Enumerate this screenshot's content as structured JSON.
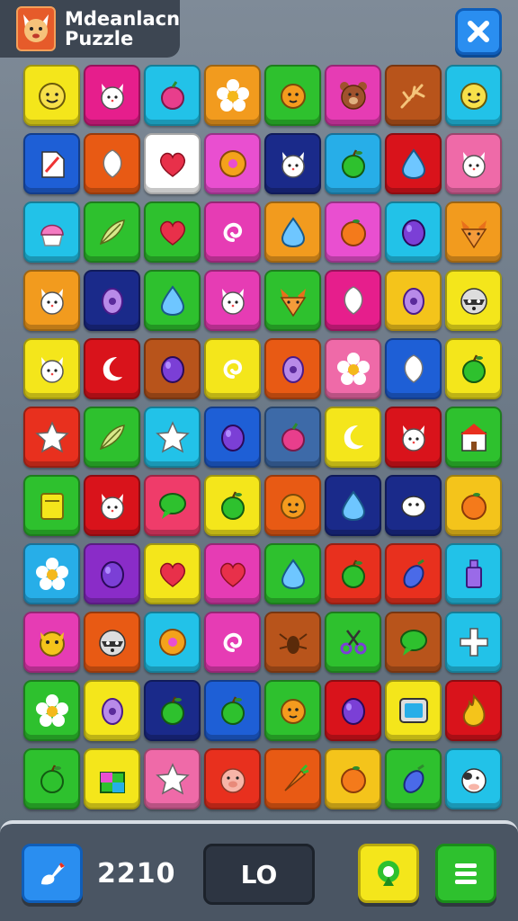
{
  "header": {
    "title_line1": "Mdeanlacn",
    "title_line2": "Puzzle"
  },
  "footer": {
    "score": "2210",
    "center_label": "LO"
  },
  "board": {
    "rows": [
      [
        [
          "#f4e61b",
          "smiley-fruit-icon"
        ],
        [
          "#e61e8c",
          "cat-icon"
        ],
        [
          "#22c2e8",
          "berry-icon"
        ],
        [
          "#f29b1e",
          "flower-icon"
        ],
        [
          "#2ec12e",
          "face-icon"
        ],
        [
          "#e63cb4",
          "bear-icon"
        ],
        [
          "#b8541b",
          "branch-icon"
        ],
        [
          "#22c2e8",
          "smiley-fruit-icon"
        ]
      ],
      [
        [
          "#1e5fd6",
          "paper-icon"
        ],
        [
          "#e85a14",
          "leaf-icon"
        ],
        [
          "#ffffff",
          "heart-icon"
        ],
        [
          "#e94fd0",
          "donut-icon"
        ],
        [
          "#1a2a8a",
          "cat-icon"
        ],
        [
          "#27aee8",
          "apple-icon"
        ],
        [
          "#d9131b",
          "drop-icon"
        ],
        [
          "#ef6aa8",
          "cat-icon"
        ]
      ],
      [
        [
          "#22c2e8",
          "cupcake-icon"
        ],
        [
          "#2ec12e",
          "feather-icon"
        ],
        [
          "#2ec12e",
          "heart-icon"
        ],
        [
          "#e63cb4",
          "swirl-icon"
        ],
        [
          "#f29b1e",
          "drop-icon"
        ],
        [
          "#e94fd0",
          "orange-icon"
        ],
        [
          "#22c2e8",
          "plum-icon"
        ],
        [
          "#f29b1e",
          "fox-icon"
        ]
      ],
      [
        [
          "#f29b1e",
          "cat-icon"
        ],
        [
          "#1a2a8a",
          "egg-icon"
        ],
        [
          "#2ec12e",
          "drop-icon"
        ],
        [
          "#e63cb4",
          "cat-icon"
        ],
        [
          "#2ec12e",
          "fox-icon"
        ],
        [
          "#e61e8c",
          "leaf-icon"
        ],
        [
          "#f4c41b",
          "egg-icon"
        ],
        [
          "#f4e61b",
          "raccoon-icon"
        ]
      ],
      [
        [
          "#f4e61b",
          "cat-icon"
        ],
        [
          "#d9131b",
          "moon-icon"
        ],
        [
          "#b8541b",
          "plum-icon"
        ],
        [
          "#f4e61b",
          "swirl-icon"
        ],
        [
          "#e85a14",
          "egg-icon"
        ],
        [
          "#ef6aa8",
          "flower-icon"
        ],
        [
          "#1e5fd6",
          "leaf-icon"
        ],
        [
          "#f4e61b",
          "apple-icon"
        ]
      ],
      [
        [
          "#e8301e",
          "star-icon"
        ],
        [
          "#2ec12e",
          "feather-icon"
        ],
        [
          "#22c2e8",
          "star-icon"
        ],
        [
          "#1e5fd6",
          "plum-icon"
        ],
        [
          "#3d6aa8",
          "berry-icon"
        ],
        [
          "#f4e61b",
          "moon-icon"
        ],
        [
          "#d9131b",
          "cat-icon"
        ],
        [
          "#2ec12e",
          "house-icon"
        ]
      ],
      [
        [
          "#2ec12e",
          "note-icon"
        ],
        [
          "#d9131b",
          "cat-icon"
        ],
        [
          "#ef3c6a",
          "chat-icon"
        ],
        [
          "#f4e61b",
          "apple-icon"
        ],
        [
          "#e85a14",
          "face-icon"
        ],
        [
          "#1a2a8a",
          "drop-icon"
        ],
        [
          "#1a2a8a",
          "ghost-icon"
        ],
        [
          "#f4c41b",
          "orange-icon"
        ]
      ],
      [
        [
          "#27aee8",
          "flower-icon"
        ],
        [
          "#8a2cc8",
          "plum-icon"
        ],
        [
          "#f4e61b",
          "heart-icon"
        ],
        [
          "#e63cb4",
          "heart-icon"
        ],
        [
          "#2ec12e",
          "drop-icon"
        ],
        [
          "#e8301e",
          "apple-icon"
        ],
        [
          "#e8301e",
          "eggplant-icon"
        ],
        [
          "#22c2e8",
          "bottle-icon"
        ]
      ],
      [
        [
          "#e63cb4",
          "owl-icon"
        ],
        [
          "#e85a14",
          "raccoon-icon"
        ],
        [
          "#22c2e8",
          "donut-icon"
        ],
        [
          "#e63cb4",
          "swirl-icon"
        ],
        [
          "#b8541b",
          "bug-icon"
        ],
        [
          "#2ec12e",
          "scissors-icon"
        ],
        [
          "#b8541b",
          "chat-icon"
        ],
        [
          "#22c2e8",
          "cross-icon"
        ]
      ],
      [
        [
          "#2ec12e",
          "flower-icon"
        ],
        [
          "#f4e61b",
          "egg-icon"
        ],
        [
          "#1a2a8a",
          "apple-icon"
        ],
        [
          "#1e5fd6",
          "apple-icon"
        ],
        [
          "#2ec12e",
          "face-icon"
        ],
        [
          "#d9131b",
          "plum-icon"
        ],
        [
          "#f4e61b",
          "tv-icon"
        ],
        [
          "#d9131b",
          "flame-icon"
        ]
      ],
      [
        [
          "#2ec12e",
          "apple-icon"
        ],
        [
          "#f4e61b",
          "box-icon"
        ],
        [
          "#ef6aa8",
          "star-icon"
        ],
        [
          "#e8301e",
          "pig-icon"
        ],
        [
          "#e85a14",
          "carrot-icon"
        ],
        [
          "#f4c41b",
          "orange-icon"
        ],
        [
          "#2ec12e",
          "eggplant-icon"
        ],
        [
          "#22c2e8",
          "cow-icon"
        ]
      ]
    ]
  },
  "colors": {
    "close_bg": "#2a8ef0",
    "bottom_bar": "#4a5563"
  }
}
